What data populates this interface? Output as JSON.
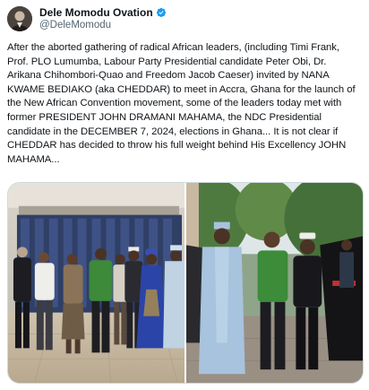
{
  "author": {
    "display_name": "Dele Momodu Ovation",
    "handle": "@DeleMomodu",
    "verified": true,
    "avatar_icon": "profile-photo"
  },
  "post": {
    "text": "After the aborted gathering of radical African leaders, (including Timi Frank, Prof. PLO Lumumba, Labour Party Presidential candidate Peter Obi, Dr. Arikana Chihombori-Quao and Freedom Jacob Caeser) invited by NANA KWAME BEDIAKO (aka CHEDDAR) to meet in Accra, Ghana for the launch of the New African Convention movement, some of the leaders today met with former PRESIDENT JOHN DRAMANI MAHAMA, the NDC Presidential candidate in the DECEMBER 7, 2024, elections in Ghana... It is not clear if CHEDDAR has decided to throw his full weight behind His Excellency JOHN MAHAMA..."
  },
  "media": {
    "count": 2,
    "photos": [
      "group-photo-indoor",
      "group-photo-outdoor"
    ]
  },
  "colors": {
    "verified_blue": "#1d9bf0",
    "handle_gray": "#536471",
    "border": "#cfd9de"
  }
}
